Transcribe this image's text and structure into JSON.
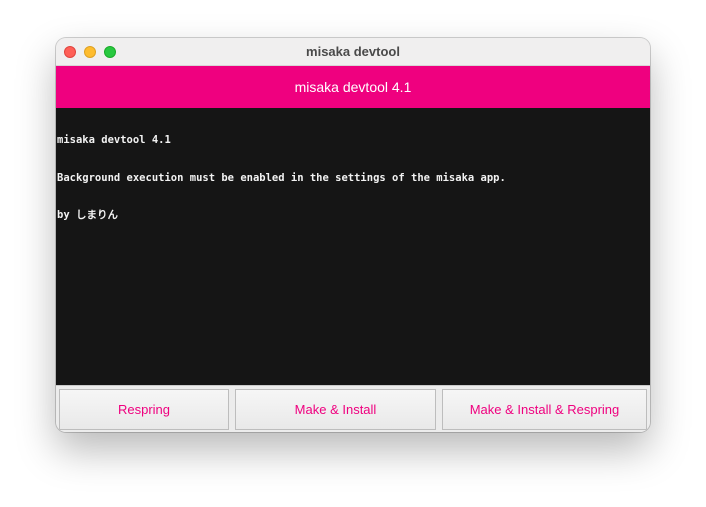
{
  "window": {
    "title": "misaka devtool"
  },
  "header": {
    "title": "misaka devtool 4.1",
    "color": "#ef007f"
  },
  "console": {
    "lines": [
      "misaka devtool 4.1",
      "Background execution must be enabled in the settings of the misaka app.",
      "by しまりん"
    ]
  },
  "buttons": {
    "respring": "Respring",
    "make_install": "Make & Install",
    "make_install_respring": "Make & Install & Respring"
  }
}
